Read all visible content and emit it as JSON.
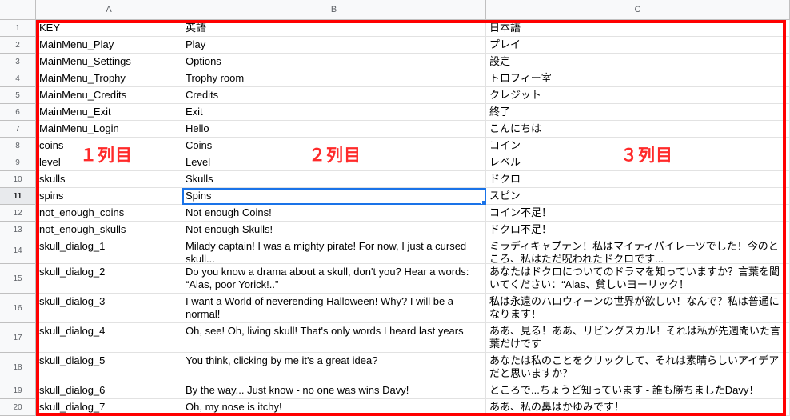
{
  "columns": [
    "A",
    "B",
    "C"
  ],
  "rows": [
    {
      "n": "1",
      "a": "KEY",
      "b": "英語",
      "c": "日本語"
    },
    {
      "n": "2",
      "a": "MainMenu_Play",
      "b": "Play",
      "c": "プレイ"
    },
    {
      "n": "3",
      "a": "MainMenu_Settings",
      "b": "Options",
      "c": "設定"
    },
    {
      "n": "4",
      "a": "MainMenu_Trophy",
      "b": "Trophy room",
      "c": "トロフィー室"
    },
    {
      "n": "5",
      "a": "MainMenu_Credits",
      "b": "Credits",
      "c": "クレジット"
    },
    {
      "n": "6",
      "a": "MainMenu_Exit",
      "b": "Exit",
      "c": "終了"
    },
    {
      "n": "7",
      "a": "MainMenu_Login",
      "b": "Hello",
      "c": "こんにちは"
    },
    {
      "n": "8",
      "a": "coins",
      "b": "Coins",
      "c": "コイン"
    },
    {
      "n": "9",
      "a": "level",
      "b": "Level",
      "c": "レベル"
    },
    {
      "n": "10",
      "a": "skulls",
      "b": "Skulls",
      "c": "ドクロ"
    },
    {
      "n": "11",
      "a": "spins",
      "b": "Spins",
      "c": "スピン"
    },
    {
      "n": "12",
      "a": "not_enough_coins",
      "b": "Not enough Coins!",
      "c": "コイン不足！"
    },
    {
      "n": "13",
      "a": "not_enough_skulls",
      "b": "Not enough Skulls!",
      "c": "ドクロ不足！"
    },
    {
      "n": "14",
      "a": "skull_dialog_1",
      "b": "Milady captain! I was a mighty pirate! For now, I just a cursed skull...",
      "c": "ミラディキャプテン！私はマイティパイレーツでした！今のところ、私はただ呪われたドクロです..."
    },
    {
      "n": "15",
      "a": "skull_dialog_2",
      "b": "Do you know a drama about a skull, don't you? Hear a words: “Alas, poor Yorick!..”",
      "c": "あなたはドクロについてのドラマを知っていますか？言葉を聞いてください：“Alas、貧しいヨーリック！"
    },
    {
      "n": "16",
      "a": "skull_dialog_3",
      "b": "I want a World of neverending Halloween! Why? I will be a normal!",
      "c": "私は永遠のハロウィーンの世界が欲しい！なんで？私は普通になります！"
    },
    {
      "n": "17",
      "a": "skull_dialog_4",
      "b": "Oh, see! Oh, living skull! That's only words I heard last years",
      "c": "ああ、見る！ああ、リビングスカル！それは私が先週聞いた言葉だけです"
    },
    {
      "n": "18",
      "a": "skull_dialog_5",
      "b": "You think, clicking by me it's a great idea?",
      "c": "あなたは私のことをクリックして、それは素晴らしいアイデアだと思いますか？"
    },
    {
      "n": "19",
      "a": "skull_dialog_6",
      "b": "By the way... Just know - no one was wins Davy!",
      "c": "ところで...ちょうど知っています - 誰も勝ちましたDavy！"
    },
    {
      "n": "20",
      "a": "skull_dialog_7",
      "b": "Oh, my nose is itchy!",
      "c": "ああ、私の鼻はかゆみです！"
    }
  ],
  "selected_cell": "B11",
  "annotations": {
    "col1": "１列目",
    "col2": "２列目",
    "col3": "３列目"
  },
  "colors": {
    "annotation": "#ff0000",
    "selection": "#1a73e8"
  }
}
